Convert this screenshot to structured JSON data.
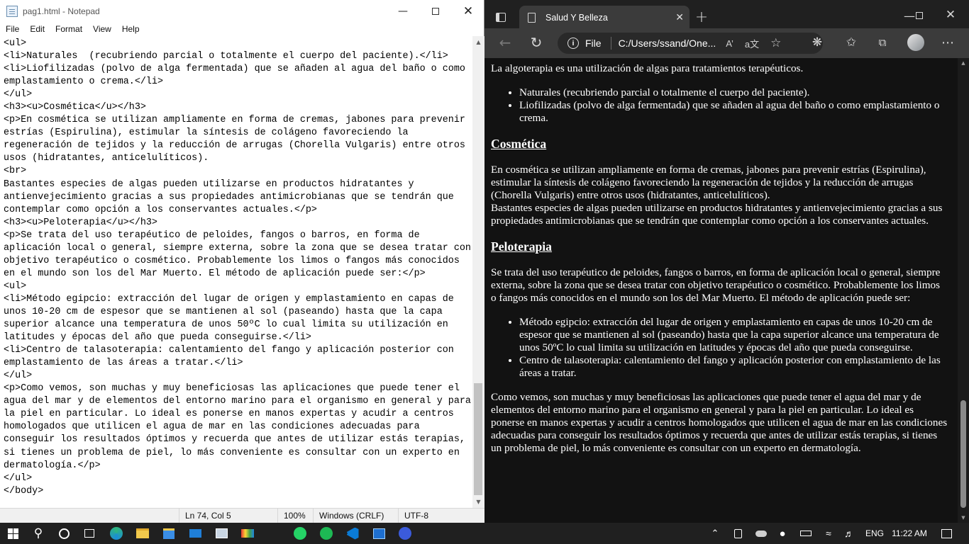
{
  "notepad": {
    "title": "pag1.html - Notepad",
    "menu": [
      "File",
      "Edit",
      "Format",
      "View",
      "Help"
    ],
    "lines": [
      "<ul>",
      "<li>Naturales  (recubriendo parcial o totalmente el cuerpo del paciente).</li>",
      "<li>Liofilizadas (polvo de alga fermentada) que se añaden al agua del baño o como",
      "emplastamiento o crema.</li>",
      "</ul>",
      "<h3><u>Cosmética</u></h3>",
      "<p>En cosmética se utilizan ampliamente en forma de cremas, jabones para prevenir",
      "estrías (Espirulina), estimular la síntesis de colágeno favoreciendo la",
      "regeneración de tejidos y la reducción de arrugas (Chorella Vulgaris) entre otros",
      "usos (hidratantes, anticelulíticos).",
      "<br>",
      "Bastantes especies de algas pueden utilizarse en productos hidratantes y",
      "antienvejecimiento gracias a sus propiedades antimicrobianas que se tendrán que",
      "contemplar como opción a los conservantes actuales.</p>",
      "<h3><u>Peloterapia</u></h3>",
      "<p>Se trata del uso terapéutico de peloides, fangos o barros, en forma de",
      "aplicación local o general, siempre externa, sobre la zona que se desea tratar con",
      "objetivo terapéutico o cosmético. Probablemente los limos o fangos más conocidos",
      "en el mundo son los del Mar Muerto. El método de aplicación puede ser:</p>",
      "<ul>",
      "<li>Método egipcio: extracción del lugar de origen y emplastamiento en capas de",
      "unos 10-20 cm de espesor que se mantienen al sol (paseando) hasta que la capa",
      "superior alcance una temperatura de unos 50ºC lo cual limita su utilización en",
      "latitudes y épocas del año que pueda conseguirse.</li>",
      "<li>Centro de talasoterapia: calentamiento del fango y aplicación posterior con",
      "emplastamiento de las áreas a tratar.</li>",
      "</ul>",
      "<p>Como vemos, son muchas y muy beneficiosas las aplicaciones que puede tener el",
      "agua del mar y de elementos del entorno marino para el organismo en general y para",
      "la piel en particular. Lo ideal es ponerse en manos expertas y acudir a centros",
      "homologados que utilicen el agua de mar en las condiciones adecuadas para",
      "conseguir los resultados óptimos y recuerda que antes de utilizar estás terapias,",
      "si tienes un problema de piel, lo más conveniente es consultar con un experto en",
      "dermatología.</p>",
      "</ul>",
      "</body>"
    ],
    "status": {
      "position": "Ln 74, Col 5",
      "zoom": "100%",
      "eol": "Windows (CRLF)",
      "encoding": "UTF-8"
    }
  },
  "edge": {
    "tab_title": "Salud Y Belleza",
    "address_scheme": "File",
    "address": "C:/Users/ssand/One...",
    "page": {
      "intro": "La algoterapia es una utilización de algas para tratamientos terapéuticos.",
      "list1": [
        "Naturales (recubriendo parcial o totalmente el cuerpo del paciente).",
        "Liofilizadas (polvo de alga fermentada) que se añaden al agua del baño o como emplastamiento o crema."
      ],
      "h_cosmetica": "Cosmética",
      "p_cosmetica": "En cosmética se utilizan ampliamente en forma de cremas, jabones para prevenir estrías (Espirulina), estimular la síntesis de colágeno favoreciendo la regeneración de tejidos y la reducción de arrugas (Chorella Vulgaris) entre otros usos (hidratantes, anticelulíticos).",
      "p_cosmetica2": "Bastantes especies de algas pueden utilizarse en productos hidratantes y antienvejecimiento gracias a sus propiedades antimicrobianas que se tendrán que contemplar como opción a los conservantes actuales.",
      "h_peloterapia": "Peloterapia",
      "p_peloterapia": "Se trata del uso terapéutico de peloides, fangos o barros, en forma de aplicación local o general, siempre externa, sobre la zona que se desea tratar con objetivo terapéutico o cosmético. Probablemente los limos o fangos más conocidos en el mundo son los del Mar Muerto. El método de aplicación puede ser:",
      "list2": [
        "Método egipcio: extracción del lugar de origen y emplastamiento en capas de unos 10-20 cm de espesor que se mantienen al sol (paseando) hasta que la capa superior alcance una temperatura de unos 50ºC lo cual limita su utilización en latitudes y épocas del año que pueda conseguirse.",
        "Centro de talasoterapia: calentamiento del fango y aplicación posterior con emplastamiento de las áreas a tratar."
      ],
      "p_final": "Como vemos, son muchas y muy beneficiosas las aplicaciones que puede tener el agua del mar y de elementos del entorno marino para el organismo en general y para la piel en particular. Lo ideal es ponerse en manos expertas y acudir a centros homologados que utilicen el agua de mar en las condiciones adecuadas para conseguir los resultados óptimos y recuerda que antes de utilizar estás terapias, si tienes un problema de piel, lo más conveniente es consultar con un experto en dermatología."
    }
  },
  "taskbar": {
    "language": "ENG",
    "time": "11:22 AM",
    "icons": [
      "start-icon",
      "search-icon",
      "cortana-icon",
      "task-view-icon",
      "edge-icon",
      "file-explorer-icon",
      "store-icon",
      "mail-icon",
      "photos-icon",
      "app-icon",
      "whatsapp-icon",
      "spotify-icon",
      "vscode-icon",
      "paint-icon",
      "chat-icon"
    ]
  },
  "colors": {
    "edge_page_bg": "#121212",
    "taskbar_bg": "#202020",
    "spotify": "#1db954",
    "whatsapp": "#25d366",
    "vscode": "#0a7bd6"
  }
}
